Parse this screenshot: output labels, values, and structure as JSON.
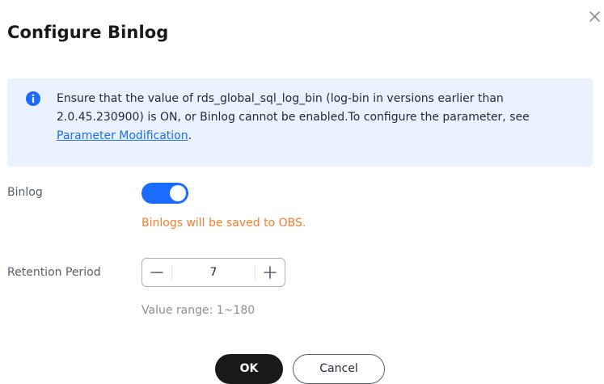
{
  "dialog": {
    "title": "Configure Binlog",
    "close_icon": "close-icon"
  },
  "alert": {
    "icon": "info-icon",
    "text": "Ensure that the value of rds_global_sql_log_bin (log-bin in versions earlier than 2.0.45.230900) is ON, or Binlog cannot be enabled.To configure the parameter, see ",
    "link_label": "Parameter Modification",
    "suffix": ".",
    "background_color": "#eaf2ff",
    "link_color": "#1a6bff"
  },
  "binlog": {
    "label": "Binlog",
    "enabled": true,
    "note": "Binlogs will be saved to OBS.",
    "note_color": "#f97d2a",
    "toggle_color": "#1a6bff"
  },
  "retention": {
    "label": "Retention Period",
    "value": "7",
    "minus_icon": "minus-icon",
    "plus_icon": "plus-icon",
    "hint": "Value range: 1~180"
  },
  "footer": {
    "ok_label": "OK",
    "cancel_label": "Cancel"
  }
}
